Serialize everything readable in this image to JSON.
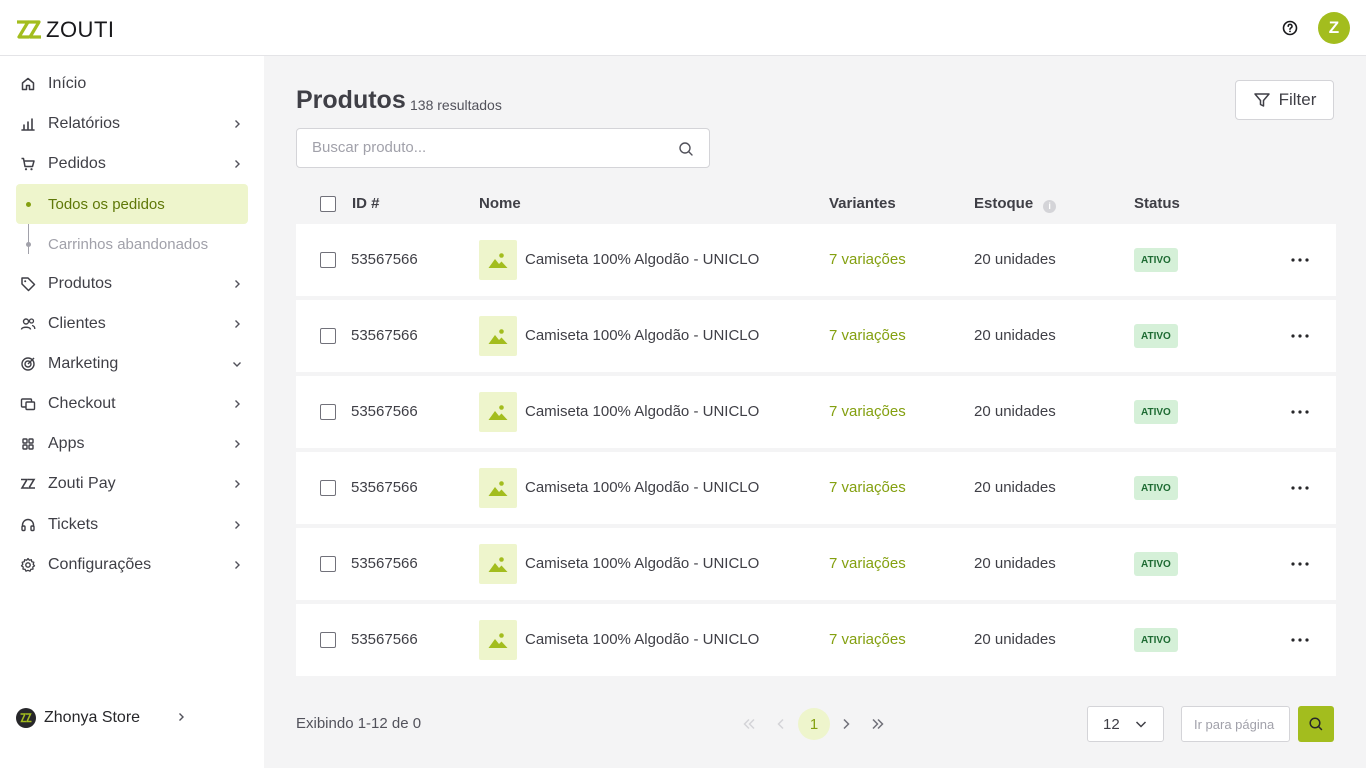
{
  "header": {
    "brand": "ZOUTI",
    "avatar_letter": "Z",
    "help_icon": "help-circle-icon"
  },
  "sidebar": {
    "items": [
      {
        "key": "inicio",
        "label": "Início",
        "icon": "home-icon",
        "chevron": "none"
      },
      {
        "key": "relatorios",
        "label": "Relatórios",
        "icon": "bar-chart-icon",
        "chevron": "right"
      },
      {
        "key": "pedidos",
        "label": "Pedidos",
        "icon": "cart-icon",
        "chevron": "right"
      },
      {
        "key": "produtos",
        "label": "Produtos",
        "icon": "tag-icon",
        "chevron": "right"
      },
      {
        "key": "clientes",
        "label": "Clientes",
        "icon": "users-icon",
        "chevron": "right"
      },
      {
        "key": "marketing",
        "label": "Marketing",
        "icon": "target-icon",
        "chevron": "down"
      },
      {
        "key": "checkout",
        "label": "Checkout",
        "icon": "checkout-icon",
        "chevron": "right"
      },
      {
        "key": "apps",
        "label": "Apps",
        "icon": "grid-icon",
        "chevron": "right"
      },
      {
        "key": "zouti-pay",
        "label": "Zouti Pay",
        "icon": "zouti-pay-icon",
        "chevron": "right"
      },
      {
        "key": "tickets",
        "label": "Tickets",
        "icon": "headset-icon",
        "chevron": "right"
      },
      {
        "key": "configuracoes",
        "label": "Configurações",
        "icon": "gear-icon",
        "chevron": "right"
      }
    ],
    "pedidos_sub": [
      {
        "label": "Todos os pedidos",
        "active": true
      },
      {
        "label": "Carrinhos abandonados",
        "active": false
      }
    ],
    "store_name": "Zhonya Store"
  },
  "main": {
    "title": "Produtos",
    "result_count": "138 resultados",
    "filter_label": "Filter",
    "search_placeholder": "Buscar produto...",
    "columns": {
      "id": "ID #",
      "name": "Nome",
      "variants": "Variantes",
      "stock": "Estoque",
      "status": "Status"
    },
    "rows": [
      {
        "id": "53567566",
        "name": "Camiseta 100% Algodão - UNICLO",
        "variants": "7 variações",
        "stock": "20 unidades",
        "status": "ATIVO"
      },
      {
        "id": "53567566",
        "name": "Camiseta 100% Algodão - UNICLO",
        "variants": "7 variações",
        "stock": "20 unidades",
        "status": "ATIVO"
      },
      {
        "id": "53567566",
        "name": "Camiseta 100% Algodão - UNICLO",
        "variants": "7 variações",
        "stock": "20 unidades",
        "status": "ATIVO"
      },
      {
        "id": "53567566",
        "name": "Camiseta 100% Algodão - UNICLO",
        "variants": "7 variações",
        "stock": "20 unidades",
        "status": "ATIVO"
      },
      {
        "id": "53567566",
        "name": "Camiseta 100% Algodão - UNICLO",
        "variants": "7 variações",
        "stock": "20 unidades",
        "status": "ATIVO"
      },
      {
        "id": "53567566",
        "name": "Camiseta 100% Algodão - UNICLO",
        "variants": "7 variações",
        "stock": "20 unidades",
        "status": "ATIVO"
      }
    ],
    "pagination": {
      "info": "Exibindo 1-12 de 0",
      "current_page": "1",
      "per_page": "12",
      "goto_placeholder": "Ir para página"
    }
  },
  "colors": {
    "accent": "#a3bd1e",
    "accent_light": "#eef5cc",
    "link": "#84a010",
    "badge_bg": "#d5f0d8",
    "badge_text": "#1e6b33"
  }
}
